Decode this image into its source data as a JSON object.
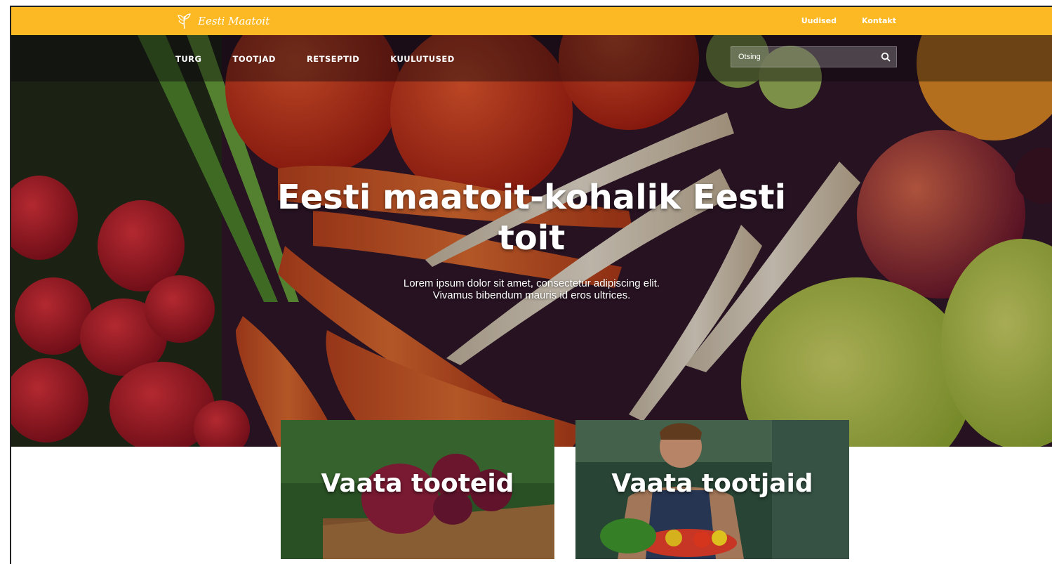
{
  "brand": {
    "name": "Eesti Maatoit"
  },
  "top_links": [
    "Uudised",
    "Kontakt"
  ],
  "nav": [
    "TURG",
    "TOOTJAD",
    "RETSEPTID",
    "KUULUTUSED"
  ],
  "search": {
    "placeholder": "Otsing"
  },
  "hero": {
    "title_line1": "Eesti maatoit-kohalik Eesti",
    "title_line2": "toit",
    "subtitle_line1": "Lorem ipsum dolor sit amet, consectetur adipiscing elit.",
    "subtitle_line2": "Vivamus bibendum mauris id eros ultrices."
  },
  "cards": [
    {
      "label": "Vaata tooteid"
    },
    {
      "label": "Vaata tootjaid"
    }
  ],
  "colors": {
    "accent": "#fdb924",
    "text_on_dark": "#ffffff"
  },
  "icons": {
    "logo": "leaf-logo-icon",
    "search": "search-icon"
  }
}
